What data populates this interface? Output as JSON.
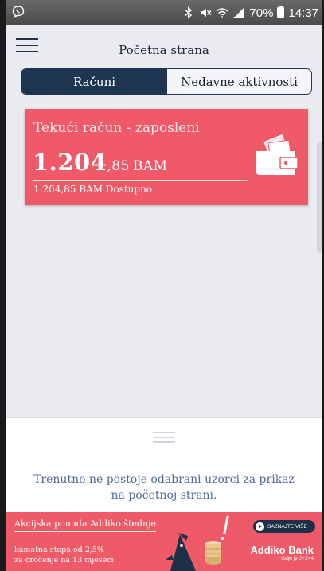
{
  "status_bar": {
    "battery": "70%",
    "time": "14:37"
  },
  "app_bar": {
    "title": "Početna strana"
  },
  "tabs": [
    {
      "label": "Računi",
      "active": true
    },
    {
      "label": "Nedavne aktivnosti",
      "active": false
    }
  ],
  "account_card": {
    "name": "Tekući račun - zaposleni",
    "balance_int": "1.204",
    "balance_dec": ",85",
    "currency": "BAM",
    "available": "1.204,85 BAM Dostupno",
    "icon": "wallet-icon"
  },
  "bottom_panel": {
    "message": "Trenutno ne postoje odabrani uzorci za prikaz na početnoj strani."
  },
  "promo": {
    "title": "Akcijska ponuda Addiko štednje",
    "line1": "kamatna stopa od 2,5%",
    "line2": "za oročenje na 13 mjeseci",
    "button": "SAZNAJTE VIŠE",
    "brand": "Addiko Bank",
    "tagline": "Gdje je 2+2=4"
  },
  "colors": {
    "accent_navy": "#1e3551",
    "card_coral": "#f05a68",
    "background": "#e9ebf0"
  }
}
